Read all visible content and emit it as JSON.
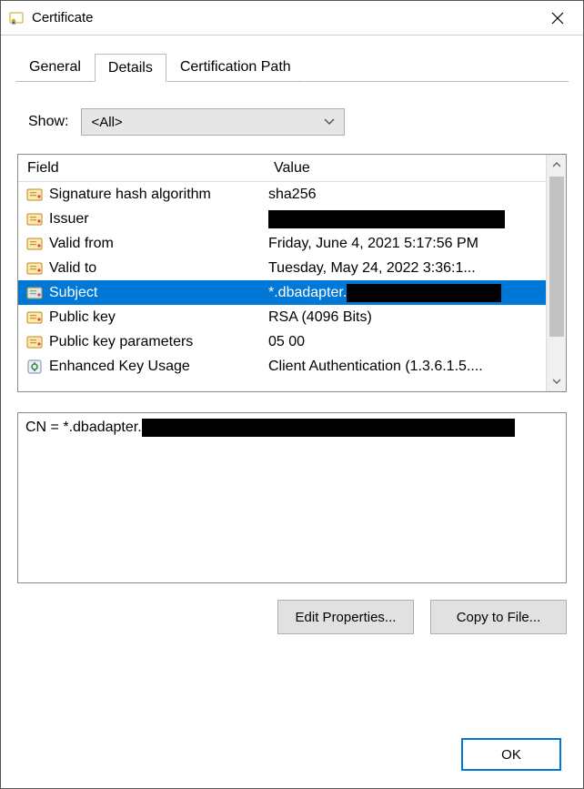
{
  "window": {
    "title": "Certificate"
  },
  "tabs": {
    "general": "General",
    "details": "Details",
    "certpath": "Certification Path",
    "active": "details"
  },
  "show": {
    "label": "Show:",
    "selected": "<All>"
  },
  "list": {
    "header_field": "Field",
    "header_value": "Value",
    "rows": [
      {
        "field": "Signature hash algorithm",
        "value": "sha256",
        "icon": "cert",
        "redact": false
      },
      {
        "field": "Issuer",
        "value": "",
        "icon": "cert",
        "redact": true
      },
      {
        "field": "Valid from",
        "value": "Friday, June 4, 2021 5:17:56 PM",
        "icon": "cert",
        "redact": false
      },
      {
        "field": "Valid to",
        "value": "Tuesday, May 24, 2022 3:36:1...",
        "icon": "cert",
        "redact": false
      },
      {
        "field": "Subject",
        "value": "*.dbadapter.",
        "icon": "cert",
        "redact": "after",
        "selected": true
      },
      {
        "field": "Public key",
        "value": "RSA (4096 Bits)",
        "icon": "cert",
        "redact": false
      },
      {
        "field": "Public key parameters",
        "value": "05 00",
        "icon": "cert",
        "redact": false
      },
      {
        "field": "Enhanced Key Usage",
        "value": "Client Authentication (1.3.6.1.5....",
        "icon": "ext",
        "redact": false
      }
    ]
  },
  "detail": {
    "prefix": "CN = *.dbadapter."
  },
  "buttons": {
    "edit": "Edit Properties...",
    "copy": "Copy to File...",
    "ok": "OK"
  }
}
